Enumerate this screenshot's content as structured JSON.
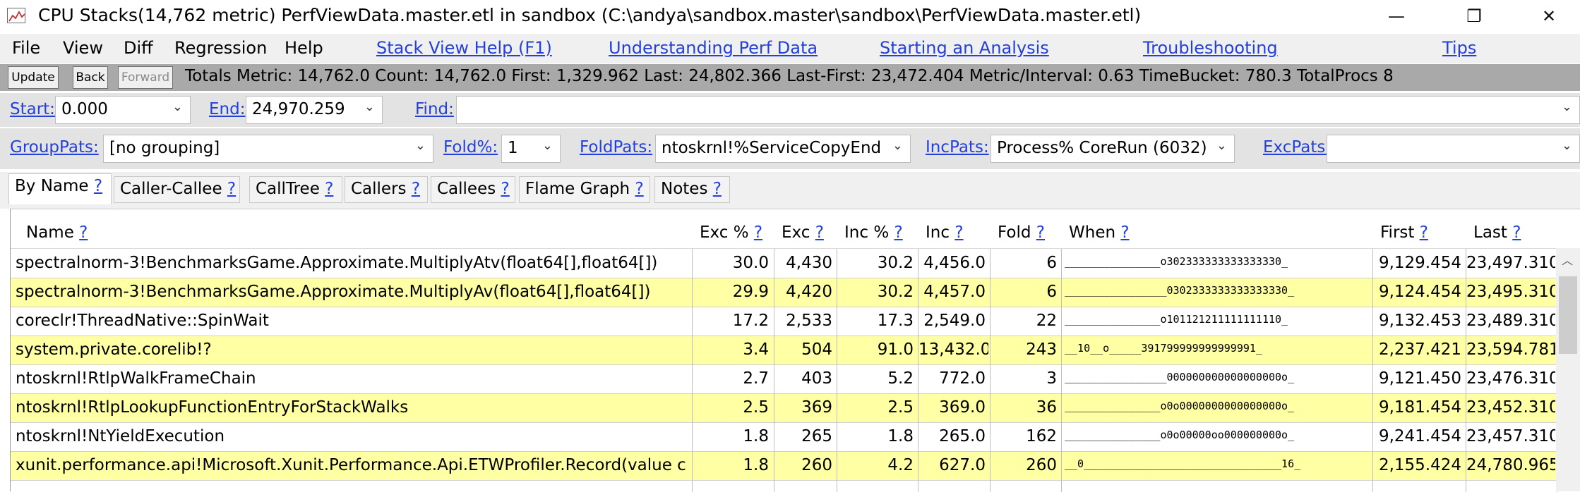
{
  "window": {
    "title": "CPU Stacks(14,762 metric) PerfViewData.master.etl in sandbox (C:\\andya\\sandbox.master\\sandbox\\PerfViewData.master.etl)",
    "minimize": "—",
    "maximize": "❐",
    "close": "✕"
  },
  "menu": {
    "items": [
      "File",
      "View",
      "Diff",
      "Regression",
      "Help"
    ],
    "links": [
      "Stack View Help (F1)",
      "Understanding Perf Data",
      "Starting an Analysis",
      "Troubleshooting",
      "Tips"
    ]
  },
  "toolbar": {
    "update": "Update",
    "back": "Back",
    "forward": "Forward",
    "stats": "Totals Metric: 14,762.0  Count: 14,762.0  First: 1,329.962  Last: 24,802.366  Last-First: 23,472.404  Metric/Interval: 0.63  TimeBucket: 780.3  TotalProcs 8"
  },
  "filters": {
    "start_label": "Start:",
    "start_value": "0.000",
    "end_label": "End:",
    "end_value": "24,970.259",
    "find_label": "Find:",
    "find_value": "",
    "grouppats_label": "GroupPats:",
    "grouppats_value": "[no grouping]",
    "fold_label": "Fold%:",
    "fold_value": "1",
    "foldpats_label": "FoldPats:",
    "foldpats_value": "ntoskrnl!%ServiceCopyEnd",
    "incpats_label": "IncPats:",
    "incpats_value": "Process% CoreRun (6032)",
    "excpats_label": "ExcPats:",
    "excpats_value": ""
  },
  "tabs": [
    "By Name",
    "Caller-Callee",
    "CallTree",
    "Callers",
    "Callees",
    "Flame Graph",
    "Notes"
  ],
  "help_mark": "?",
  "grid": {
    "columns": [
      "Name",
      "Exc %",
      "Exc",
      "Inc %",
      "Inc",
      "Fold",
      "When",
      "First",
      "Last"
    ],
    "rows": [
      {
        "name": "spectralnorm-3!BenchmarksGame.Approximate.MultiplyAtv(float64[],float64[])",
        "exc_pct": "30.0",
        "exc": "4,430",
        "inc_pct": "30.2",
        "inc": "4,456.0",
        "fold": "6",
        "when": "_______________o302333333333333330_",
        "first": "9,129.454",
        "last": "23,497.310"
      },
      {
        "name": "spectralnorm-3!BenchmarksGame.Approximate.MultiplyAv(float64[],float64[])",
        "exc_pct": "29.9",
        "exc": "4,420",
        "inc_pct": "30.2",
        "inc": "4,457.0",
        "fold": "6",
        "when": "________________0302333333333333330_",
        "first": "9,124.454",
        "last": "23,495.310"
      },
      {
        "name": "coreclr!ThreadNative::SpinWait",
        "exc_pct": "17.2",
        "exc": "2,533",
        "inc_pct": "17.3",
        "inc": "2,549.0",
        "fold": "22",
        "when": "_______________o101121211111111110_",
        "first": "9,132.453",
        "last": "23,489.310"
      },
      {
        "name": "system.private.corelib!?",
        "exc_pct": "3.4",
        "exc": "504",
        "inc_pct": "91.0",
        "inc": "13,432.0",
        "fold": "243",
        "when": "__10__o_____391799999999999991_",
        "first": "2,237.421",
        "last": "23,594.781"
      },
      {
        "name": "ntoskrnl!RtlpWalkFrameChain",
        "exc_pct": "2.7",
        "exc": "403",
        "inc_pct": "5.2",
        "inc": "772.0",
        "fold": "3",
        "when": "________________000000000000000000o_",
        "first": "9,121.450",
        "last": "23,476.310"
      },
      {
        "name": "ntoskrnl!RtlpLookupFunctionEntryForStackWalks",
        "exc_pct": "2.5",
        "exc": "369",
        "inc_pct": "2.5",
        "inc": "369.0",
        "fold": "36",
        "when": "_______________o0o0000000000000000o_",
        "first": "9,181.454",
        "last": "23,452.310"
      },
      {
        "name": "ntoskrnl!NtYieldExecution",
        "exc_pct": "1.8",
        "exc": "265",
        "inc_pct": "1.8",
        "inc": "265.0",
        "fold": "162",
        "when": "_______________o0o00000oo000000000o_",
        "first": "9,241.454",
        "last": "23,457.310"
      },
      {
        "name": "xunit.performance.api!Microsoft.Xunit.Performance.Api.ETWProfiler.Record(value c",
        "exc_pct": "1.8",
        "exc": "260",
        "inc_pct": "4.2",
        "inc": "627.0",
        "fold": "260",
        "when": "__0_______________________________16_",
        "first": "2,155.424",
        "last": "24,780.965"
      }
    ]
  },
  "colors": {
    "link": "#2340d8",
    "stats_bar": "#a9a9a9",
    "filter_bar": "#e3e3e3",
    "row_highlight": "#ffffa4"
  },
  "icons": [
    "app-icon",
    "minimize-icon",
    "maximize-icon",
    "close-icon",
    "chevron-down-icon",
    "scroll-up-icon"
  ]
}
